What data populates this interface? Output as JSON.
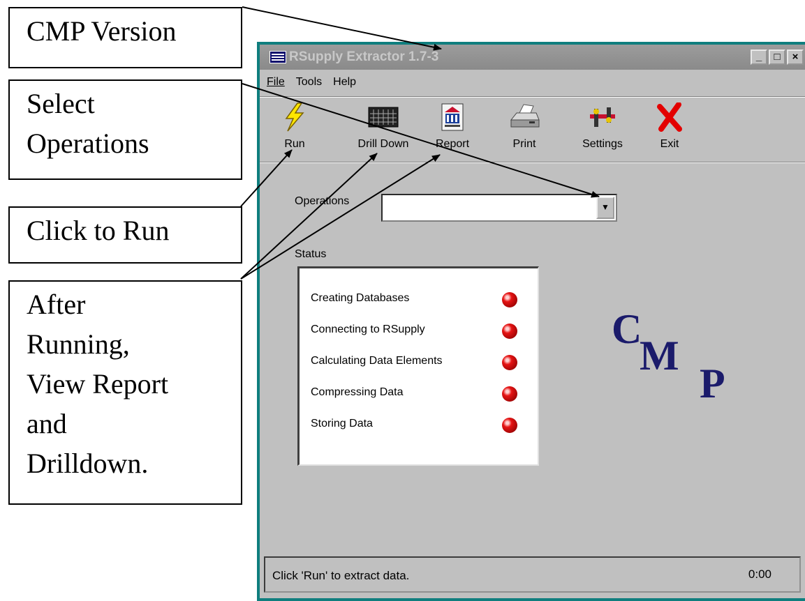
{
  "callouts": {
    "version": [
      "CMP Version"
    ],
    "select": [
      "Select",
      "Operations"
    ],
    "click_run": [
      "Click to Run"
    ],
    "after": [
      "After",
      "Running,",
      "View Report",
      "and",
      "Drilldown."
    ]
  },
  "window": {
    "title": "RSupply Extractor 1.7-3",
    "controls": [
      "_",
      "□",
      "×"
    ]
  },
  "menu": [
    "File",
    "Tools",
    "Help"
  ],
  "toolbar": [
    {
      "label": "Run",
      "icon": "lightning-icon"
    },
    {
      "label": "Drill Down",
      "icon": "grid-icon"
    },
    {
      "label": "Report",
      "icon": "report-icon"
    },
    {
      "label": "Print",
      "icon": "printer-icon"
    },
    {
      "label": "Settings",
      "icon": "settings-icon"
    },
    {
      "label": "Exit",
      "icon": "exit-x-icon"
    }
  ],
  "operations": {
    "label": "Operations",
    "value": ""
  },
  "status": {
    "label": "Status",
    "items": [
      {
        "text": "Creating Databases",
        "state": "red"
      },
      {
        "text": "Connecting to RSupply",
        "state": "red"
      },
      {
        "text": "Calculating Data Elements",
        "state": "red"
      },
      {
        "text": "Compressing Data",
        "state": "red"
      },
      {
        "text": "Storing Data",
        "state": "red"
      }
    ]
  },
  "logo": {
    "c": "C",
    "m": "M",
    "p": "P"
  },
  "statusbar": {
    "message": "Click 'Run' to extract data.",
    "time": "0:00"
  },
  "colors": {
    "window_border": "#0f7e7e",
    "face": "#c0c0c0",
    "logo": "#1b1b6b",
    "led": "#e61414"
  }
}
